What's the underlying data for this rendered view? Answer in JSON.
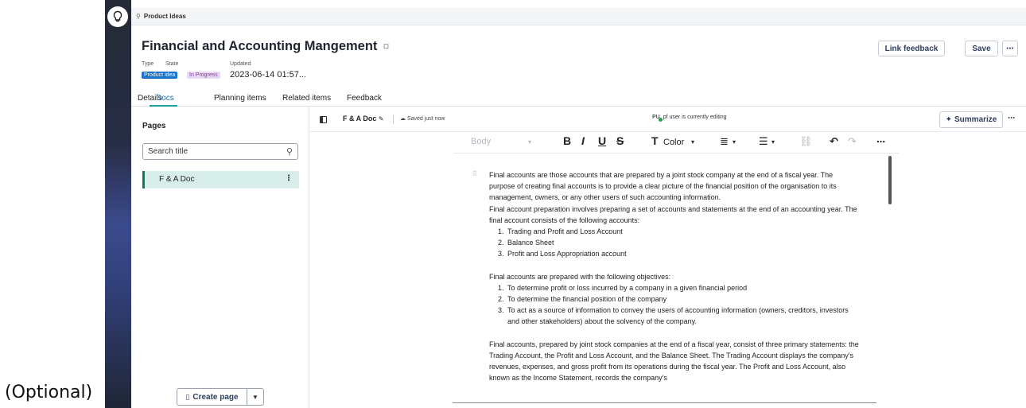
{
  "outer": {
    "caption": "(Optional)"
  },
  "breadcrumb": {
    "label": "Product Ideas"
  },
  "header": {
    "title": "Financial and Accounting Mangement",
    "type_label": "Type",
    "state_label": "State",
    "updated_label": "Updated",
    "type_value": "Product idea",
    "state_value": "In Progress",
    "updated_value": "2023-06-14 01:57...",
    "link_feedback": "Link feedback",
    "save": "Save",
    "more": "⋯"
  },
  "tabs": [
    {
      "label": "Details"
    },
    {
      "label": "Docs"
    },
    {
      "label": "Planning items"
    },
    {
      "label": "Related items"
    },
    {
      "label": "Feedback"
    }
  ],
  "pages_panel": {
    "title": "Pages",
    "search_placeholder": "Search title",
    "items": [
      {
        "label": "F & A Doc"
      }
    ],
    "create_label": "Create page"
  },
  "doc": {
    "name": "F & A Doc",
    "saved_status": "Saved just now",
    "editor_initials": "PU",
    "editing_status": "pf user is currently editing",
    "summarize": "Summarize"
  },
  "toolbar": {
    "style": "Body",
    "bold": "B",
    "italic": "I",
    "underline": "U",
    "strike": "S",
    "color_glyph": "T",
    "color": "Color",
    "more": "⋯"
  },
  "content": {
    "p1": "Final accounts are those accounts that are prepared by a joint stock company at the end of a fiscal year. The purpose of creating final accounts is to provide a clear picture of the financial position of the organisation to its management, owners, or any other users of such accounting information.",
    "p2": "Final account preparation involves preparing a set of accounts and statements at the end of an accounting year. The final account consists of the following accounts:",
    "list1": [
      "Trading and Profit and Loss Account",
      "Balance Sheet",
      "Profit and Loss Appropriation account"
    ],
    "p3": "Final accounts are prepared with the following objectives:",
    "list2": [
      "To determine profit or loss incurred by a company in a given financial period",
      "To determine the financial position of the company",
      "To act as a source of information to convey the users of accounting information (owners, creditors, investors and other stakeholders) about the solvency of the company."
    ],
    "p4": "Final accounts, prepared by joint stock companies at the end of a fiscal year, consist of three primary statements: the Trading Account, the Profit and Loss Account, and the Balance Sheet. The Trading Account displays the company's revenues, expenses, and gross profit from its operations during the fiscal year. The Profit and Loss Account, also known as the Income Statement, records the company's"
  },
  "colors": {
    "primary": "#1a73c8",
    "teal": "#0a7d64",
    "rail": "#272d44"
  },
  "icons": [
    "lightbulb-icon",
    "pin-icon",
    "tag-icon",
    "search-icon",
    "kebab-icon",
    "panel-toggle-icon",
    "pencil-icon",
    "cloud-icon",
    "link-icon",
    "undo-icon",
    "redo-icon",
    "list-icon",
    "align-icon",
    "sparkle-icon",
    "document-icon",
    "chevron-down-icon"
  ]
}
